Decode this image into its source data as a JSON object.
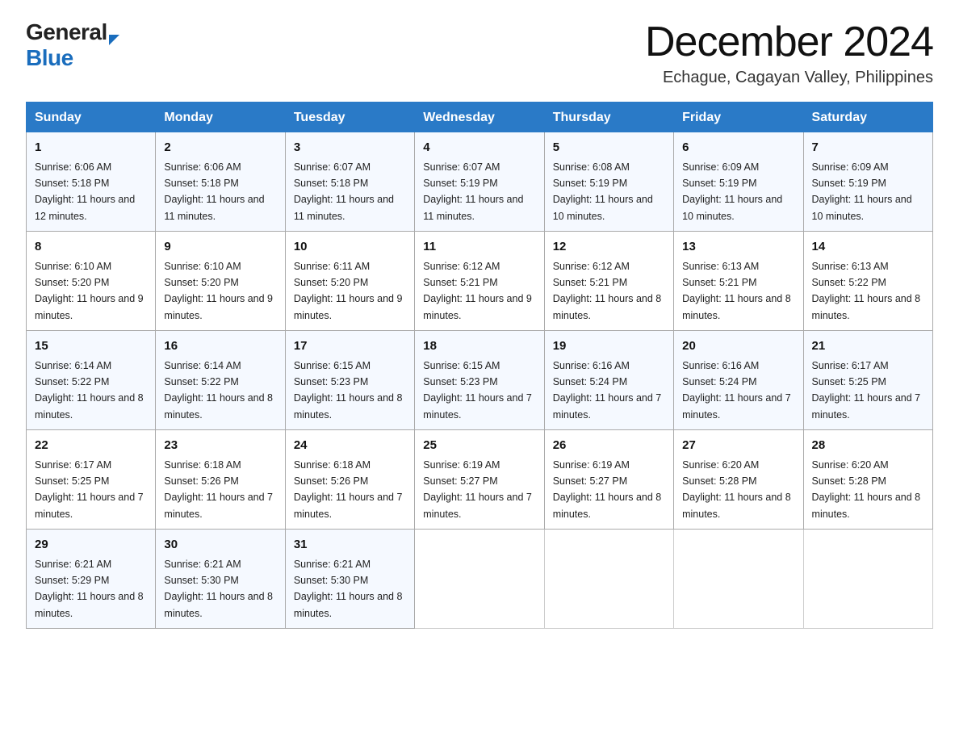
{
  "logo": {
    "general": "General",
    "blue": "Blue",
    "arrow": "▶"
  },
  "title": {
    "month": "December 2024",
    "location": "Echague, Cagayan Valley, Philippines"
  },
  "weekdays": [
    "Sunday",
    "Monday",
    "Tuesday",
    "Wednesday",
    "Thursday",
    "Friday",
    "Saturday"
  ],
  "weeks": [
    [
      {
        "day": "1",
        "sunrise": "6:06 AM",
        "sunset": "5:18 PM",
        "daylight": "11 hours and 12 minutes."
      },
      {
        "day": "2",
        "sunrise": "6:06 AM",
        "sunset": "5:18 PM",
        "daylight": "11 hours and 11 minutes."
      },
      {
        "day": "3",
        "sunrise": "6:07 AM",
        "sunset": "5:18 PM",
        "daylight": "11 hours and 11 minutes."
      },
      {
        "day": "4",
        "sunrise": "6:07 AM",
        "sunset": "5:19 PM",
        "daylight": "11 hours and 11 minutes."
      },
      {
        "day": "5",
        "sunrise": "6:08 AM",
        "sunset": "5:19 PM",
        "daylight": "11 hours and 10 minutes."
      },
      {
        "day": "6",
        "sunrise": "6:09 AM",
        "sunset": "5:19 PM",
        "daylight": "11 hours and 10 minutes."
      },
      {
        "day": "7",
        "sunrise": "6:09 AM",
        "sunset": "5:19 PM",
        "daylight": "11 hours and 10 minutes."
      }
    ],
    [
      {
        "day": "8",
        "sunrise": "6:10 AM",
        "sunset": "5:20 PM",
        "daylight": "11 hours and 9 minutes."
      },
      {
        "day": "9",
        "sunrise": "6:10 AM",
        "sunset": "5:20 PM",
        "daylight": "11 hours and 9 minutes."
      },
      {
        "day": "10",
        "sunrise": "6:11 AM",
        "sunset": "5:20 PM",
        "daylight": "11 hours and 9 minutes."
      },
      {
        "day": "11",
        "sunrise": "6:12 AM",
        "sunset": "5:21 PM",
        "daylight": "11 hours and 9 minutes."
      },
      {
        "day": "12",
        "sunrise": "6:12 AM",
        "sunset": "5:21 PM",
        "daylight": "11 hours and 8 minutes."
      },
      {
        "day": "13",
        "sunrise": "6:13 AM",
        "sunset": "5:21 PM",
        "daylight": "11 hours and 8 minutes."
      },
      {
        "day": "14",
        "sunrise": "6:13 AM",
        "sunset": "5:22 PM",
        "daylight": "11 hours and 8 minutes."
      }
    ],
    [
      {
        "day": "15",
        "sunrise": "6:14 AM",
        "sunset": "5:22 PM",
        "daylight": "11 hours and 8 minutes."
      },
      {
        "day": "16",
        "sunrise": "6:14 AM",
        "sunset": "5:22 PM",
        "daylight": "11 hours and 8 minutes."
      },
      {
        "day": "17",
        "sunrise": "6:15 AM",
        "sunset": "5:23 PM",
        "daylight": "11 hours and 8 minutes."
      },
      {
        "day": "18",
        "sunrise": "6:15 AM",
        "sunset": "5:23 PM",
        "daylight": "11 hours and 7 minutes."
      },
      {
        "day": "19",
        "sunrise": "6:16 AM",
        "sunset": "5:24 PM",
        "daylight": "11 hours and 7 minutes."
      },
      {
        "day": "20",
        "sunrise": "6:16 AM",
        "sunset": "5:24 PM",
        "daylight": "11 hours and 7 minutes."
      },
      {
        "day": "21",
        "sunrise": "6:17 AM",
        "sunset": "5:25 PM",
        "daylight": "11 hours and 7 minutes."
      }
    ],
    [
      {
        "day": "22",
        "sunrise": "6:17 AM",
        "sunset": "5:25 PM",
        "daylight": "11 hours and 7 minutes."
      },
      {
        "day": "23",
        "sunrise": "6:18 AM",
        "sunset": "5:26 PM",
        "daylight": "11 hours and 7 minutes."
      },
      {
        "day": "24",
        "sunrise": "6:18 AM",
        "sunset": "5:26 PM",
        "daylight": "11 hours and 7 minutes."
      },
      {
        "day": "25",
        "sunrise": "6:19 AM",
        "sunset": "5:27 PM",
        "daylight": "11 hours and 7 minutes."
      },
      {
        "day": "26",
        "sunrise": "6:19 AM",
        "sunset": "5:27 PM",
        "daylight": "11 hours and 8 minutes."
      },
      {
        "day": "27",
        "sunrise": "6:20 AM",
        "sunset": "5:28 PM",
        "daylight": "11 hours and 8 minutes."
      },
      {
        "day": "28",
        "sunrise": "6:20 AM",
        "sunset": "5:28 PM",
        "daylight": "11 hours and 8 minutes."
      }
    ],
    [
      {
        "day": "29",
        "sunrise": "6:21 AM",
        "sunset": "5:29 PM",
        "daylight": "11 hours and 8 minutes."
      },
      {
        "day": "30",
        "sunrise": "6:21 AM",
        "sunset": "5:30 PM",
        "daylight": "11 hours and 8 minutes."
      },
      {
        "day": "31",
        "sunrise": "6:21 AM",
        "sunset": "5:30 PM",
        "daylight": "11 hours and 8 minutes."
      },
      null,
      null,
      null,
      null
    ]
  ]
}
